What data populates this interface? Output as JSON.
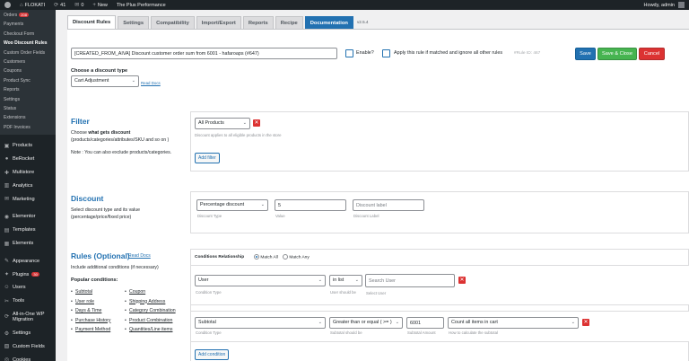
{
  "adminbar": {
    "site": "FLOKATI",
    "updates": "41",
    "comments": "0",
    "new": "New",
    "plus": "The Plus Performance",
    "howdy": "Howdy, admin"
  },
  "sidebar": {
    "sub_items": [
      {
        "label": "Orders",
        "badge": "208"
      },
      {
        "label": "Payments",
        "badge": ""
      },
      {
        "label": "Checkout Form",
        "badge": ""
      },
      {
        "label": "Woo Discount Rules",
        "badge": ""
      },
      {
        "label": "Custom Order Fields",
        "badge": ""
      },
      {
        "label": "Customers",
        "badge": ""
      },
      {
        "label": "Coupons",
        "badge": ""
      },
      {
        "label": "Product Sync",
        "badge": ""
      },
      {
        "label": "Reports",
        "badge": ""
      },
      {
        "label": "Settings",
        "badge": ""
      },
      {
        "label": "Status",
        "badge": ""
      },
      {
        "label": "Extensions",
        "badge": ""
      },
      {
        "label": "PDF Invoices",
        "badge": ""
      }
    ],
    "menu_group1": [
      {
        "label": "Products",
        "icon": "▣"
      },
      {
        "label": "BeRocket",
        "icon": "●"
      },
      {
        "label": "Multistore",
        "icon": "✚"
      },
      {
        "label": "Analytics",
        "icon": "▥"
      },
      {
        "label": "Marketing",
        "icon": "✉"
      }
    ],
    "menu_group2": [
      {
        "label": "Elementor",
        "icon": "◉"
      },
      {
        "label": "Templates",
        "icon": "▤"
      },
      {
        "label": "Elements",
        "icon": "▦"
      }
    ],
    "menu_group3": [
      {
        "label": "Appearance",
        "icon": "✎",
        "badge": ""
      },
      {
        "label": "Plugins",
        "icon": "✦",
        "badge": "30"
      },
      {
        "label": "Users",
        "icon": "☺",
        "badge": ""
      },
      {
        "label": "Tools",
        "icon": "✂",
        "badge": ""
      }
    ],
    "migration": {
      "line1": "All-in-One WP",
      "line2": "Migration",
      "icon": "⟳"
    },
    "menu_group4": [
      {
        "label": "Settings",
        "icon": "⚙"
      },
      {
        "label": "Custom Fields",
        "icon": "▧"
      },
      {
        "label": "Cookies",
        "icon": "◎"
      }
    ]
  },
  "tabs": [
    "Discount Rules",
    "Settings",
    "Compatibility",
    "Import/Export",
    "Reports",
    "Recipe",
    "Documentation"
  ],
  "version": "v2.5.4",
  "rule": {
    "title": "[CREATED_FROM_AIVA] Discount customer order sum from 6001 - hafaroaps (#647)",
    "enable_label": "Enable?",
    "apply_label": "Apply this rule if matched and ignore all other rules",
    "rule_id": "#Rule ID: 467",
    "save": "Save",
    "save_close": "Save & Close",
    "cancel": "Cancel",
    "discount_type_label": "Choose a discount type",
    "discount_type_value": "Cart Adjustment",
    "read_docs": "Read Docs"
  },
  "filter": {
    "title": "Filter",
    "desc_pre": "Choose ",
    "desc_bold": "what gets discount",
    "desc_post": "(products/categories/attributes/SKU and so on )",
    "note": "Note : You can also exclude products/categories.",
    "select_value": "All Products",
    "hint": "Discount applies to all eligible products in the store",
    "add_filter": "Add filter"
  },
  "discount": {
    "title": "Discount",
    "desc": "Select discount type and its value (percentage/price/fixed price)",
    "type_value": "Percentage discount",
    "value": "5",
    "label_placeholder": "Discount label",
    "type_hint": "Discount Type",
    "value_hint": "Value",
    "label_hint": "Discount Label"
  },
  "rules": {
    "title": "Rules (Optional)",
    "read_docs": "Read Docs",
    "desc": "Include additional conditions (if necessary)",
    "popular_title": "Popular conditions:",
    "popular_col1": [
      "Subtotal",
      "User role",
      "Days & Time",
      "Purchase History",
      "Payment Method"
    ],
    "popular_col2": [
      "Coupon",
      "Shipping Address",
      "Category Combination",
      "Product Combination",
      "Quantities/Line items"
    ],
    "relationship_label": "Conditions Relationship",
    "match_all": "Match All",
    "match_any": "Match Any",
    "cond1": {
      "type": "User",
      "op": "in list",
      "search_placeholder": "Search User",
      "type_hint": "Condition Type",
      "op_hint": "User should be",
      "value_hint": "Select User"
    },
    "cond2": {
      "type": "Subtotal",
      "op": "Greater than or equal ( >= )",
      "amount": "6001",
      "calc": "Count all items in cart",
      "type_hint": "Condition Type",
      "op_hint": "Subtotal should be",
      "amount_hint": "Subtotal Amount",
      "calc_hint": "How to calculate the subtotal"
    },
    "add_condition": "Add condition"
  }
}
